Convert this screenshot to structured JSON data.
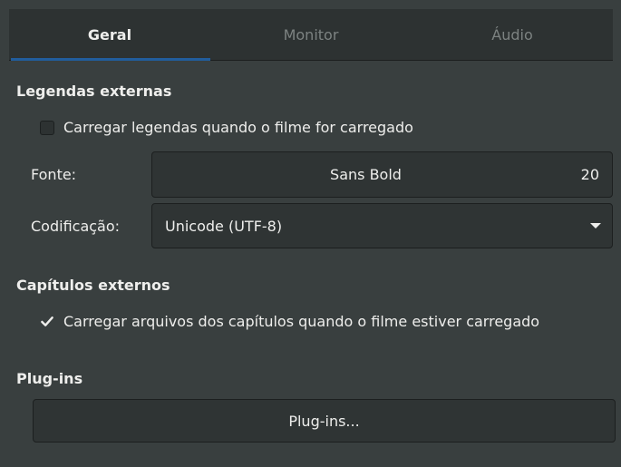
{
  "tabs": [
    {
      "label": "Geral",
      "active": true
    },
    {
      "label": "Monitor",
      "active": false
    },
    {
      "label": "Áudio",
      "active": false
    }
  ],
  "subtitles": {
    "title": "Legendas externas",
    "load_checkbox": {
      "label": "Carregar legendas quando o filme for carregado",
      "checked": false
    },
    "font_label": "Fonte:",
    "font_name": "Sans Bold",
    "font_size": "20",
    "encoding_label": "Codificação:",
    "encoding_value": "Unicode (UTF-8)"
  },
  "chapters": {
    "title": "Capítulos externos",
    "load_checkbox": {
      "label": "Carregar arquivos dos capítulos quando o filme estiver carregado",
      "checked": true
    }
  },
  "plugins": {
    "title": "Plug-ins",
    "button_label": "Plug-ins..."
  },
  "colors": {
    "background": "#393f3f",
    "accent": "#215d9c",
    "text": "#eeeeec"
  }
}
